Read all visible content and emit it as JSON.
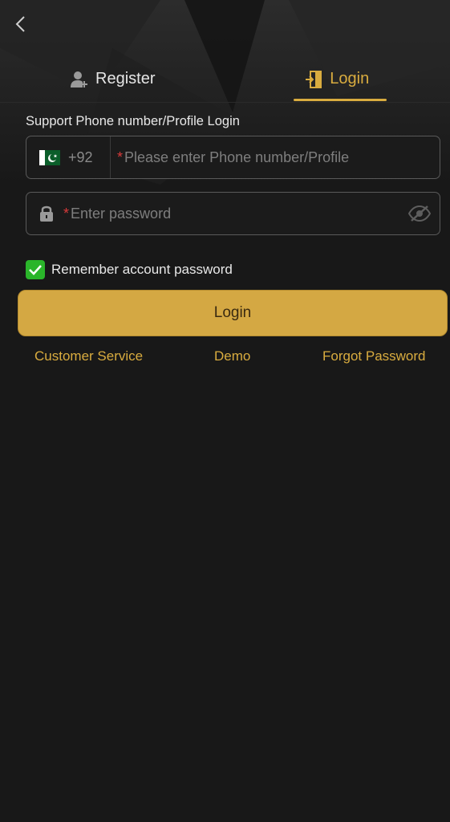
{
  "tabs": [
    {
      "label": "Register",
      "icon": "user-plus-icon",
      "active": false
    },
    {
      "label": "Login",
      "icon": "login-door-icon",
      "active": true
    }
  ],
  "hint": "Support Phone number/Profile Login",
  "phone": {
    "country_code": "+92",
    "country_flag": "pakistan-flag-icon",
    "required_mark": "*",
    "placeholder": "Please enter Phone number/Profile"
  },
  "password": {
    "required_mark": "*",
    "placeholder": "Enter password"
  },
  "remember": {
    "label": "Remember account password",
    "checked": true
  },
  "login_button": "Login",
  "links": {
    "customer_service": "Customer Service",
    "demo": "Demo",
    "forgot_password": "Forgot Password"
  },
  "colors": {
    "accent": "#d9ac3f",
    "button": "#d4a843",
    "background": "#181818",
    "checkbox": "#2ab52a",
    "required": "#d93a3a"
  }
}
